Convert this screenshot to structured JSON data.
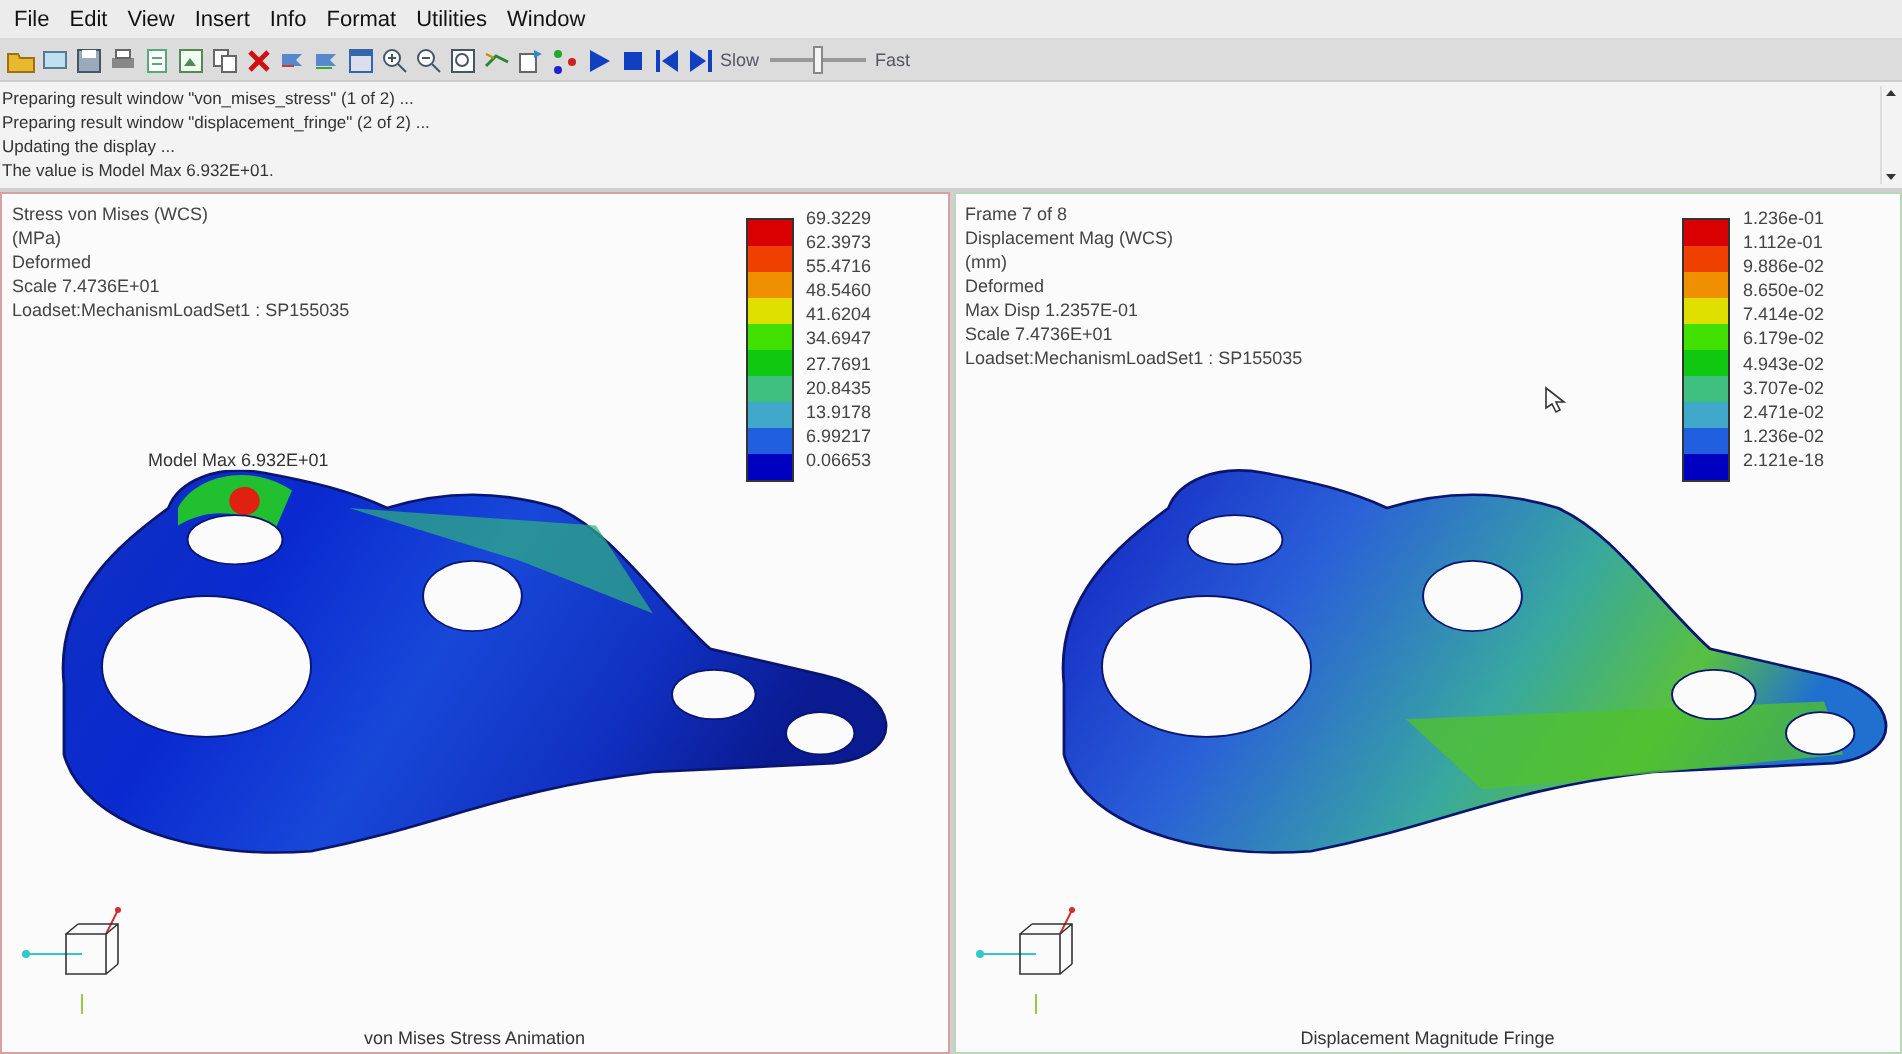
{
  "menu": [
    "File",
    "Edit",
    "View",
    "Insert",
    "Info",
    "Format",
    "Utilities",
    "Window"
  ],
  "toolbar": {
    "slider": {
      "min_label": "Slow",
      "max_label": "Fast",
      "level": 0.5
    }
  },
  "messages": [
    "Preparing result window \"von_mises_stress\" (1 of 2) ...",
    "Preparing result window \"displacement_fringe\" (2 of 2) ...",
    "Updating the display ...",
    "The value is Model Max  6.932E+01."
  ],
  "views": [
    {
      "selected": true,
      "kind": "stress",
      "info": [
        "Stress von Mises (WCS)",
        "(MPa)",
        "Deformed",
        "Scale  7.4736E+01",
        "Loadset:MechanismLoadSet1  :  SP155035"
      ],
      "max_label": "Model Max  6.932E+01",
      "legend": {
        "values": [
          "69.3229",
          "62.3973",
          "55.4716",
          "48.5460",
          "41.6204",
          "34.6947",
          "27.7691",
          "20.8435",
          "13.9178",
          "6.99217",
          "0.06653"
        ]
      },
      "caption": "von Mises Stress Animation"
    },
    {
      "selected": false,
      "kind": "displacement",
      "info": [
        "Frame 7 of 8",
        "Displacement Mag (WCS)",
        "(mm)",
        "Deformed",
        "Max Disp  1.2357E-01",
        "Scale  7.4736E+01",
        "Loadset:MechanismLoadSet1  :  SP155035"
      ],
      "legend": {
        "values": [
          "1.236e-01",
          "1.112e-01",
          "9.886e-02",
          "8.650e-02",
          "7.414e-02",
          "6.179e-02",
          "4.943e-02",
          "3.707e-02",
          "2.471e-02",
          "1.236e-02",
          "2.121e-18"
        ]
      },
      "caption": "Displacement Magnitude Fringe"
    }
  ],
  "legend_bands": [
    {
      "color": "#d80000"
    },
    {
      "color": "#f04000"
    },
    {
      "color": "#f09000"
    },
    {
      "color": "#e0e000"
    },
    {
      "color": "#40e000"
    },
    {
      "color": "#10c810"
    },
    {
      "color": "#40c080"
    },
    {
      "color": "#40a8c8"
    },
    {
      "color": "#2060e0"
    },
    {
      "color": "#0000c0"
    }
  ]
}
